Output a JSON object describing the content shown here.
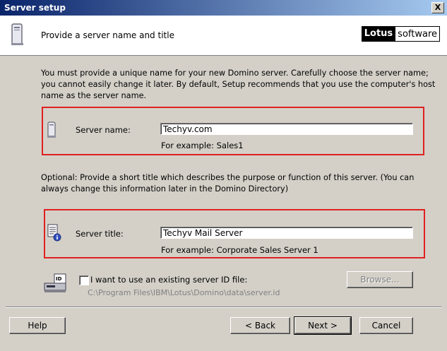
{
  "window": {
    "title": "Server setup",
    "close_label": "X"
  },
  "header": {
    "heading": "Provide a server name and title",
    "brand_lotus": "Lotus",
    "brand_software": "software",
    "icon": "server-tower-icon"
  },
  "intro_text": "You must provide a unique name for your new Domino server. Carefully choose the server name; you cannot easily change it later. By default, Setup recommends that you use the computer's host name as the server name.",
  "server_name": {
    "label": "Server name:",
    "value": "Techyv.com",
    "example": "For example: Sales1",
    "icon": "server-icon"
  },
  "optional_text": "Optional: Provide a short title which describes the purpose or function of this server. (You can always change this information later in the Domino Directory)",
  "server_title": {
    "label": "Server title:",
    "value": "Techyv Mail Server",
    "example": "For example: Corporate Sales Server 1",
    "icon": "document-info-icon"
  },
  "server_id": {
    "checkbox_label": "I want to use an existing server ID file:",
    "checked": false,
    "path": "C:\\Program Files\\IBM\\Lotus\\Domino\\data\\server.id",
    "browse_label": "Browse...",
    "icon": "id-card-drive-icon"
  },
  "buttons": {
    "help": "Help",
    "back_prefix": "< ",
    "back": "Back",
    "next": "Next >",
    "cancel": "Cancel"
  },
  "colors": {
    "highlight_box": "#e02020",
    "titlebar": "#0a246a",
    "dialog_bg": "#d4d0c8"
  }
}
